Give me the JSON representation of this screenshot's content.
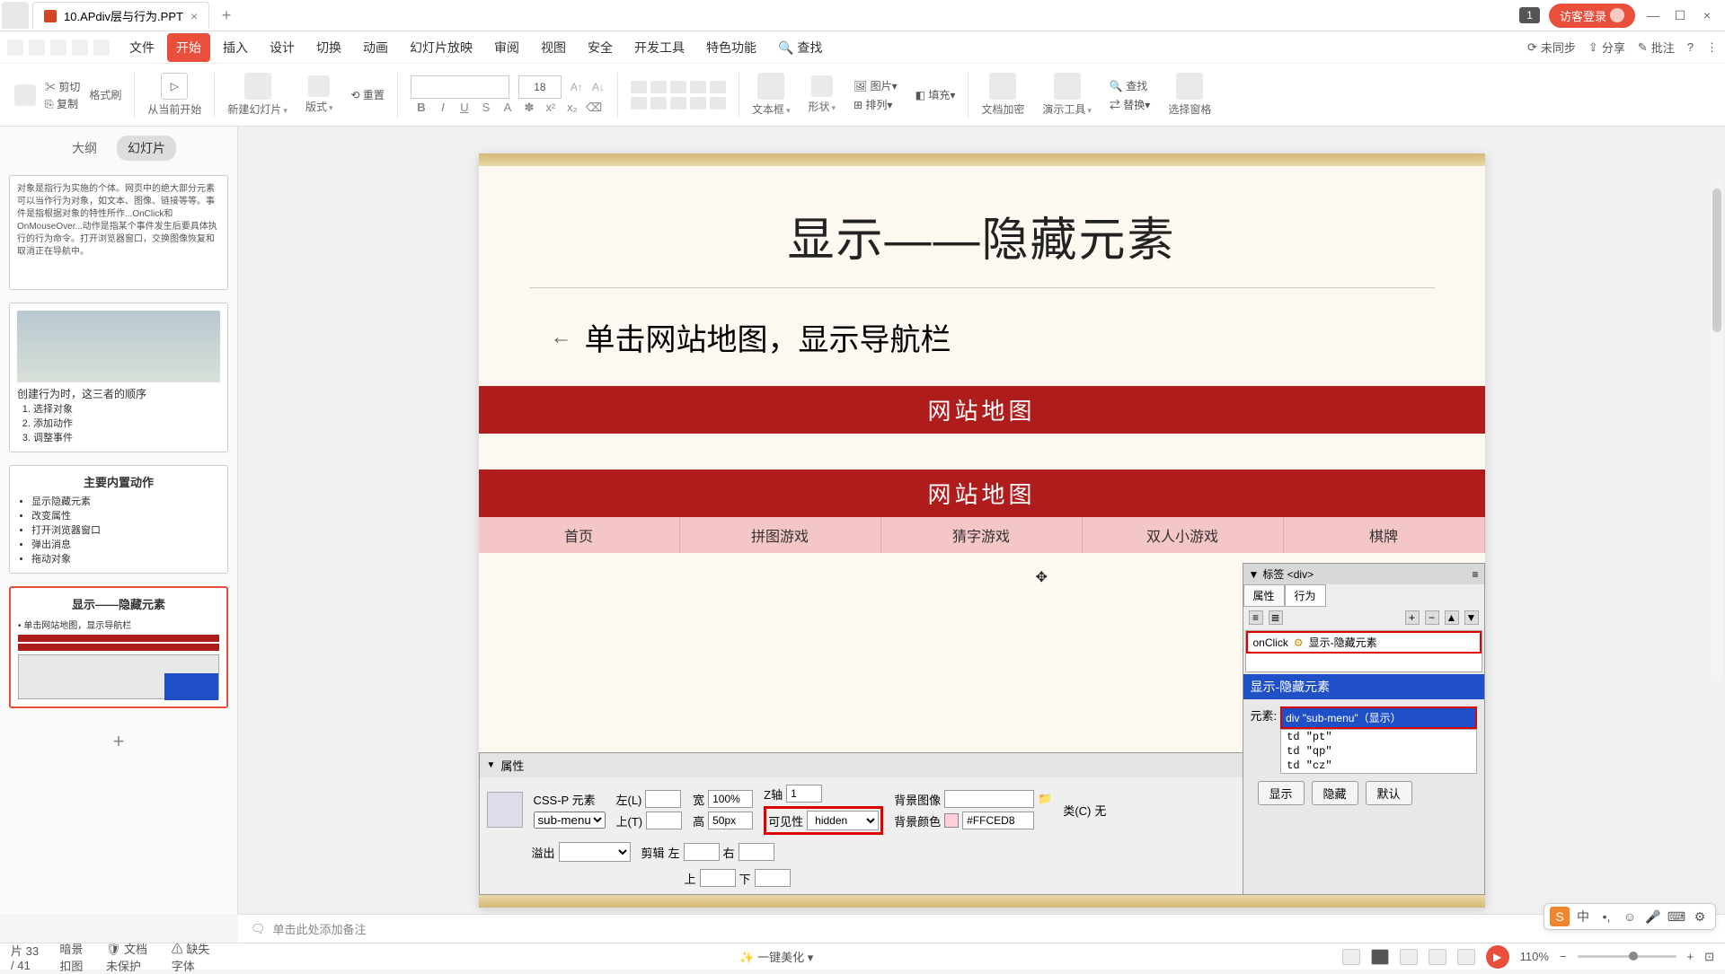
{
  "titlebar": {
    "doc_name": "10.APdiv层与行为.PPT",
    "login": "访客登录",
    "badge": "1"
  },
  "menubar": {
    "items": [
      "文件",
      "开始",
      "插入",
      "设计",
      "切换",
      "动画",
      "幻灯片放映",
      "审阅",
      "视图",
      "安全",
      "开发工具",
      "特色功能"
    ],
    "search": "查找",
    "right": {
      "sync": "未同步",
      "share": "分享",
      "comment": "批注"
    }
  },
  "ribbon": {
    "cut": "剪切",
    "copy": "复制",
    "format_painter": "格式刷",
    "play_from_current": "从当前开始",
    "new_slide": "新建幻灯片",
    "layout": "版式",
    "reset": "重置",
    "font_size_value": "18",
    "textbox": "文本框",
    "shape": "形状",
    "image": "图片",
    "arrange": "排列",
    "fill": "填充",
    "find": "查找",
    "replace": "替换",
    "doc_encrypt": "文档加密",
    "present_tools": "演示工具",
    "select_pane": "选择窗格"
  },
  "sidebar": {
    "tabs": {
      "outline": "大纲",
      "slides": "幻灯片"
    },
    "thumb1_text": "对象是指行为实施的个体。网页中的绝大部分元素可以当作行为对象，如文本、图像、链接等等。事件是指根据对象的特性所作...OnClick和OnMouseOver...动作是指某个事件发生后要具体执行的行为命令。打开浏览器窗口，交换图像恢复和取消正在导航中。",
    "thumb2_title": "创建行为时，这三者的顺序",
    "thumb2_list": [
      "选择对象",
      "添加动作",
      "调整事件"
    ],
    "thumb3_title": "主要内置动作",
    "thumb3_list": [
      "显示隐藏元素",
      "改变属性",
      "打开浏览器窗口",
      "弹出消息",
      "拖动对象"
    ],
    "thumb4_title": "显示——隐藏元素",
    "thumb4_bullet": "单击网站地图，显示导航栏"
  },
  "slide": {
    "title": "显示——隐藏元素",
    "bullet": "单击网站地图，显示导航栏",
    "sitemap_label": "网站地图",
    "nav_items": [
      "首页",
      "拼图游戏",
      "猜字游戏",
      "双人小游戏",
      "棋牌"
    ]
  },
  "prop_panel": {
    "header": "属性",
    "cssp": "CSS-P 元素",
    "select_val": "sub-menu",
    "left_l": "左(L)",
    "top_t": "上(T)",
    "width_l": "宽",
    "width_v": "100%",
    "height_l": "高",
    "height_v": "50px",
    "z_l": "Z轴",
    "z_v": "1",
    "vis_l": "可见性",
    "vis_v": "hidden",
    "bgimg_l": "背景图像",
    "bgcolor_l": "背景颜色",
    "bgcolor_v": "#FFCED8",
    "class_l": "类(C)",
    "class_v": "无",
    "overflow_l": "溢出",
    "clip_l": "剪辑",
    "clip_left": "左",
    "clip_right": "右",
    "clip_top": "上",
    "clip_bottom": "下"
  },
  "tag_panel": {
    "header": "标签 <div>",
    "tabs": {
      "attr": "属性",
      "behav": "行为"
    },
    "event": "onClick",
    "action": "显示-隐藏元素",
    "blue_title": "显示-隐藏元素",
    "elem_label": "元素:",
    "elem_sel": "div \"sub-menu\"（显示）",
    "elem_list": [
      "td \"pt\"",
      "td \"qp\"",
      "td \"cz\""
    ],
    "btns": {
      "show": "显示",
      "hide": "隐藏",
      "default": "默认"
    }
  },
  "notes": "单击此处添加备注",
  "statusbar": {
    "page": "片 33 / 41",
    "dark": "暗景扣图",
    "protect": "文档未保护",
    "missing_font": "缺失字体",
    "beautify": "一键美化",
    "zoom": "110%"
  },
  "ime": {
    "lang": "中"
  }
}
